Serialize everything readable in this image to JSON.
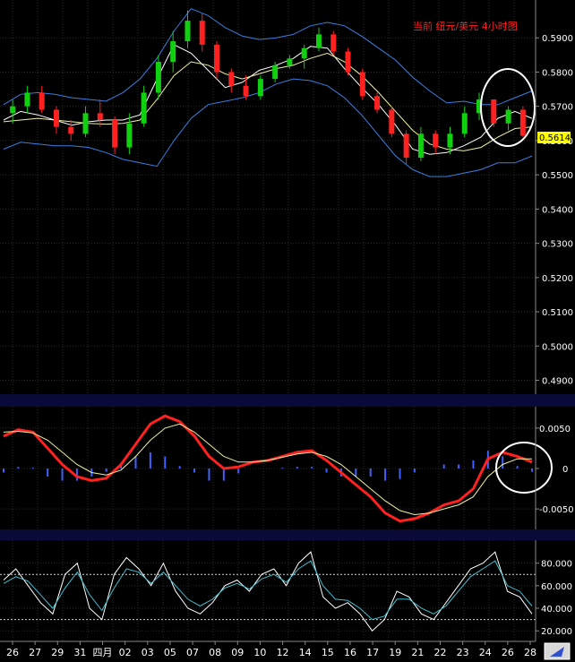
{
  "chart_data": [
    {
      "type": "candlestick",
      "title": "当前 纽元/美元 4小时图",
      "last_price": "0.5614",
      "ylim": [
        0.487,
        0.6
      ],
      "yticks": [
        "0.5900",
        "0.5800",
        "0.5700",
        "0.5600",
        "0.5500",
        "0.5400",
        "0.5300",
        "0.5200",
        "0.5100",
        "0.5000",
        "0.4900"
      ],
      "grid": true,
      "series": [
        {
          "name": "",
          "style": "bollinger-upper",
          "color": "#3a7fe0",
          "y": [
            0.5705,
            0.5735,
            0.574,
            0.5735,
            0.5725,
            0.572,
            0.5715,
            0.574,
            0.578,
            0.584,
            0.592,
            0.5985,
            0.5965,
            0.593,
            0.5905,
            0.5895,
            0.59,
            0.591,
            0.5935,
            0.5945,
            0.5935,
            0.5905,
            0.587,
            0.5835,
            0.5785,
            0.5745,
            0.571,
            0.5715,
            0.5705,
            0.5705,
            0.5725,
            0.5745
          ]
        },
        {
          "name": "",
          "style": "bollinger-lower",
          "color": "#3a7fe0",
          "y": [
            0.5575,
            0.5595,
            0.559,
            0.5585,
            0.5585,
            0.558,
            0.5565,
            0.5545,
            0.5535,
            0.5525,
            0.56,
            0.5665,
            0.5705,
            0.5715,
            0.5725,
            0.574,
            0.5765,
            0.578,
            0.5775,
            0.576,
            0.5725,
            0.5675,
            0.5615,
            0.5555,
            0.5515,
            0.5495,
            0.5495,
            0.5505,
            0.5515,
            0.5535,
            0.5535,
            0.5555
          ]
        },
        {
          "name": "",
          "style": "ma-fast",
          "color": "#ffffff",
          "y": [
            0.566,
            0.5685,
            0.5675,
            0.566,
            0.5645,
            0.5655,
            0.566,
            0.566,
            0.5675,
            0.578,
            0.588,
            0.5855,
            0.5805,
            0.5755,
            0.577,
            0.5805,
            0.582,
            0.584,
            0.5875,
            0.587,
            0.581,
            0.5755,
            0.5705,
            0.5645,
            0.5575,
            0.556,
            0.5565,
            0.5585,
            0.561,
            0.5665,
            0.5685,
            0.5665
          ]
        },
        {
          "name": "",
          "style": "ma-slow",
          "color": "#f0f0a0",
          "y": [
            0.5655,
            0.566,
            0.5665,
            0.566,
            0.5655,
            0.565,
            0.5648,
            0.565,
            0.566,
            0.572,
            0.579,
            0.583,
            0.582,
            0.5795,
            0.578,
            0.5795,
            0.581,
            0.582,
            0.584,
            0.5855,
            0.583,
            0.579,
            0.574,
            0.5685,
            0.563,
            0.559,
            0.5575,
            0.557,
            0.558,
            0.561,
            0.5635,
            0.564
          ]
        }
      ],
      "candles": [
        [
          0.568,
          0.572,
          0.565,
          0.57
        ],
        [
          0.57,
          0.576,
          0.568,
          0.574
        ],
        [
          0.574,
          0.576,
          0.568,
          0.569
        ],
        [
          0.569,
          0.57,
          0.562,
          0.564
        ],
        [
          0.564,
          0.566,
          0.56,
          0.562
        ],
        [
          0.562,
          0.57,
          0.561,
          0.568
        ],
        [
          0.568,
          0.572,
          0.564,
          0.566
        ],
        [
          0.566,
          0.567,
          0.556,
          0.558
        ],
        [
          0.558,
          0.568,
          0.556,
          0.565
        ],
        [
          0.565,
          0.576,
          0.564,
          0.574
        ],
        [
          0.574,
          0.585,
          0.572,
          0.583
        ],
        [
          0.583,
          0.592,
          0.58,
          0.589
        ],
        [
          0.589,
          0.598,
          0.587,
          0.595
        ],
        [
          0.595,
          0.597,
          0.586,
          0.588
        ],
        [
          0.588,
          0.589,
          0.578,
          0.58
        ],
        [
          0.58,
          0.581,
          0.574,
          0.576
        ],
        [
          0.576,
          0.579,
          0.572,
          0.573
        ],
        [
          0.573,
          0.579,
          0.572,
          0.578
        ],
        [
          0.578,
          0.583,
          0.577,
          0.582
        ],
        [
          0.582,
          0.585,
          0.581,
          0.584
        ],
        [
          0.584,
          0.588,
          0.581,
          0.587
        ],
        [
          0.587,
          0.593,
          0.586,
          0.591
        ],
        [
          0.591,
          0.592,
          0.585,
          0.586
        ],
        [
          0.586,
          0.587,
          0.579,
          0.58
        ],
        [
          0.58,
          0.581,
          0.572,
          0.573
        ],
        [
          0.573,
          0.574,
          0.568,
          0.569
        ],
        [
          0.569,
          0.57,
          0.561,
          0.562
        ],
        [
          0.562,
          0.563,
          0.553,
          0.555
        ],
        [
          0.555,
          0.564,
          0.554,
          0.562
        ],
        [
          0.562,
          0.563,
          0.556,
          0.558
        ],
        [
          0.558,
          0.564,
          0.556,
          0.562
        ],
        [
          0.562,
          0.57,
          0.561,
          0.568
        ],
        [
          0.568,
          0.574,
          0.566,
          0.572
        ],
        [
          0.572,
          0.572,
          0.564,
          0.565
        ],
        [
          0.565,
          0.57,
          0.563,
          0.569
        ],
        [
          0.569,
          0.57,
          0.561,
          0.5614
        ]
      ],
      "annotation": "circle"
    },
    {
      "type": "line",
      "ylim": [
        -0.0072,
        0.0072
      ],
      "yticks": [
        "0.0050",
        "0",
        "-0.0050"
      ],
      "grid": true,
      "series": [
        {
          "name": "",
          "style": "signal-fast",
          "color": "#ff2020",
          "y": [
            0.004,
            0.0048,
            0.0045,
            0.0025,
            0.0005,
            -0.001,
            -0.0015,
            -0.0012,
            0.0005,
            0.003,
            0.0055,
            0.0065,
            0.0058,
            0.004,
            0.0015,
            0.0,
            0.0002,
            0.0008,
            0.001,
            0.0015,
            0.002,
            0.0022,
            0.001,
            -0.0005,
            -0.002,
            -0.0035,
            -0.0055,
            -0.0065,
            -0.0062,
            -0.0055,
            -0.0045,
            -0.004,
            -0.0025,
            0.0012,
            0.002,
            0.0015,
            0.0008
          ]
        },
        {
          "name": "",
          "style": "signal-slow",
          "color": "#f0f0a0",
          "y": [
            0.0045,
            0.0046,
            0.0044,
            0.0035,
            0.002,
            0.0005,
            -0.0005,
            -0.0008,
            -0.0002,
            0.0015,
            0.0035,
            0.005,
            0.0055,
            0.0045,
            0.003,
            0.0015,
            0.0008,
            0.0008,
            0.001,
            0.0014,
            0.0018,
            0.002,
            0.0015,
            0.0005,
            -0.001,
            -0.0025,
            -0.004,
            -0.0052,
            -0.0057,
            -0.0055,
            -0.005,
            -0.0045,
            -0.0035,
            -0.001,
            0.0005,
            0.0012,
            0.0012
          ]
        },
        {
          "name": "",
          "style": "histogram",
          "color": "#4060ff",
          "y": [
            -0.0005,
            0.0002,
            0.0001,
            -0.001,
            -0.0015,
            -0.0015,
            -0.001,
            -0.0004,
            0.0007,
            0.0015,
            0.002,
            0.0015,
            0.0003,
            -0.0005,
            -0.0015,
            -0.0015,
            -0.0006,
            0.0,
            0.0,
            0.0001,
            0.0002,
            0.0002,
            -0.0005,
            -0.001,
            -0.001,
            -0.001,
            -0.0015,
            -0.0013,
            -0.0005,
            0.0,
            0.0005,
            0.0005,
            0.001,
            0.0022,
            0.0015,
            0.0003,
            -0.0004
          ]
        }
      ],
      "annotation": "circle"
    },
    {
      "type": "line",
      "ylim": [
        13,
        98
      ],
      "yticks": [
        "80.000",
        "60.000",
        "40.000",
        "20.000"
      ],
      "dashed_levels": [
        70,
        30
      ],
      "categories": [
        "26",
        "27",
        "29",
        "31",
        "四月",
        "02",
        "03",
        "05",
        "07",
        "08",
        "09",
        "10",
        "12",
        "14",
        "15",
        "16",
        "17",
        "19",
        "21",
        "22",
        "23",
        "24",
        "26",
        "28"
      ],
      "grid": true,
      "series": [
        {
          "name": "",
          "style": "oscillator-fast",
          "color": "#ffffff",
          "y": [
            65,
            75,
            60,
            45,
            35,
            70,
            80,
            40,
            30,
            70,
            85,
            75,
            60,
            80,
            55,
            40,
            35,
            45,
            60,
            65,
            55,
            70,
            75,
            60,
            80,
            90,
            50,
            40,
            45,
            35,
            20,
            30,
            55,
            50,
            35,
            30,
            45,
            60,
            75,
            80,
            90,
            55,
            50,
            35
          ]
        },
        {
          "name": "",
          "style": "oscillator-slow",
          "color": "#40c0d0",
          "y": [
            62,
            68,
            64,
            52,
            40,
            58,
            72,
            52,
            38,
            58,
            75,
            72,
            62,
            72,
            60,
            48,
            42,
            48,
            58,
            62,
            57,
            66,
            70,
            63,
            75,
            82,
            60,
            48,
            47,
            40,
            30,
            33,
            48,
            48,
            40,
            35,
            42,
            55,
            68,
            75,
            82,
            60,
            55,
            42
          ]
        }
      ]
    }
  ]
}
